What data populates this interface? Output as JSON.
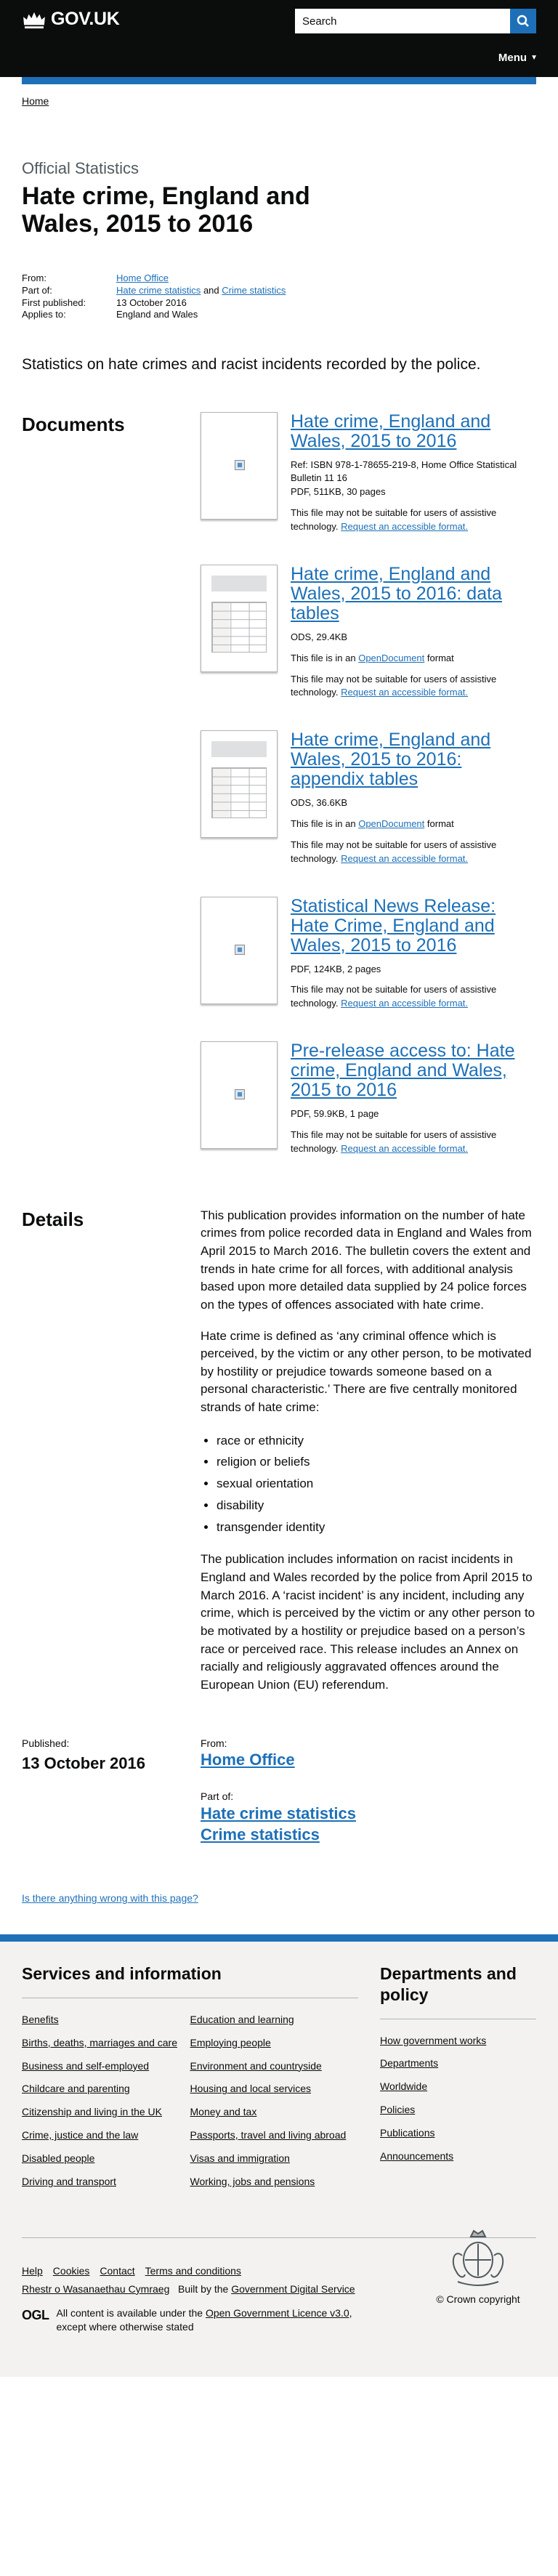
{
  "header": {
    "logo_text": "GOV.UK",
    "search_placeholder": "Search",
    "menu_label": "Menu"
  },
  "breadcrumb": {
    "home": "Home"
  },
  "page": {
    "caption": "Official Statistics",
    "title": "Hate crime, England and Wales, 2015 to 2016",
    "lede": "Statistics on hate crimes and racist incidents recorded by the police."
  },
  "meta": {
    "from_label": "From:",
    "from_value": "Home Office",
    "partof_label": "Part of:",
    "partof_1": "Hate crime statistics",
    "partof_and": "and",
    "partof_2": "Crime statistics",
    "published_label": "First published:",
    "published_value": "13 October 2016",
    "applies_label": "Applies to:",
    "applies_value": "England and Wales"
  },
  "documents": {
    "heading": "Documents",
    "accessibility_note": "This file may not be suitable for users of assistive technology.",
    "accessible_link": "Request an accessible format.",
    "open_doc_prefix": "This file is in an",
    "open_doc_link": "OpenDocument",
    "open_doc_suffix": "format",
    "items": [
      {
        "title": "Hate crime, England and Wales, 2015 to 2016",
        "ref": "Ref: ISBN 978-1-78655-219-8, Home Office Statistical Bulletin 11 16",
        "attr": "PDF, 511KB, 30 pages"
      },
      {
        "title": "Hate crime, England and Wales, 2015 to 2016: data tables",
        "attr": "ODS, 29.4KB"
      },
      {
        "title": "Hate crime, England and Wales, 2015 to 2016: appendix tables",
        "attr": "ODS, 36.6KB"
      },
      {
        "title": "Statistical News Release: Hate Crime, England and Wales, 2015 to 2016",
        "attr": "PDF, 124KB, 2 pages"
      },
      {
        "title": "Pre-release access to: Hate crime, England and Wales, 2015 to 2016",
        "attr": "PDF, 59.9KB, 1 page"
      }
    ]
  },
  "details": {
    "heading": "Details",
    "p1": "This publication provides information on the number of hate crimes from police recorded data in England and Wales from April 2015 to March 2016. The bulletin covers the extent and trends in hate crime for all forces, with additional analysis based upon more detailed data supplied by 24 police forces on the types of offences associated with hate crime.",
    "p2": "Hate crime is defined as ‘any criminal offence which is perceived, by the victim or any other person, to be motivated by hostility or prejudice towards someone based on a personal characteristic.’ There are five centrally monitored strands of hate crime:",
    "list": [
      "race or ethnicity",
      "religion or beliefs",
      "sexual orientation",
      "disability",
      "transgender identity"
    ],
    "p3": "The publication includes information on racist incidents in England and Wales recorded by the police from April 2015 to March 2016. A ‘racist incident’ is any incident, including any crime, which is perceived by the victim or any other person to be motivated by a hostility or prejudice based on a person’s race or perceived race. This release includes an Annex on racially and religiously aggravated offences around the European Union (EU) referendum."
  },
  "published": {
    "label": "Published:",
    "date": "13 October 2016",
    "from_label": "From:",
    "from": "Home Office",
    "partof_label": "Part of:",
    "partof": [
      "Hate crime statistics",
      "Crime statistics"
    ]
  },
  "report_link": "Is there anything wrong with this page?",
  "footer": {
    "services_heading": "Services and information",
    "services_col1": [
      "Benefits",
      "Births, deaths, marriages and care",
      "Business and self-employed",
      "Childcare and parenting",
      "Citizenship and living in the UK",
      "Crime, justice and the law",
      "Disabled people",
      "Driving and transport"
    ],
    "services_col2": [
      "Education and learning",
      "Employing people",
      "Environment and countryside",
      "Housing and local services",
      "Money and tax",
      "Passports, travel and living abroad",
      "Visas and immigration",
      "Working, jobs and pensions"
    ],
    "dept_heading": "Departments and policy",
    "dept_list": [
      "How government works",
      "Departments",
      "Worldwide",
      "Policies",
      "Publications",
      "Announcements"
    ],
    "help_links": [
      "Help",
      "Cookies",
      "Contact",
      "Terms and conditions",
      "Rhestr o Wasanaethau Cymraeg"
    ],
    "built_prefix": "Built by the",
    "built_link": "Government Digital Service",
    "ogl": "OGL",
    "licence_prefix": "All content is available under the",
    "licence_link": "Open Government Licence v3.0,",
    "licence_suffix": "except where otherwise stated",
    "copyright": "© Crown copyright"
  }
}
